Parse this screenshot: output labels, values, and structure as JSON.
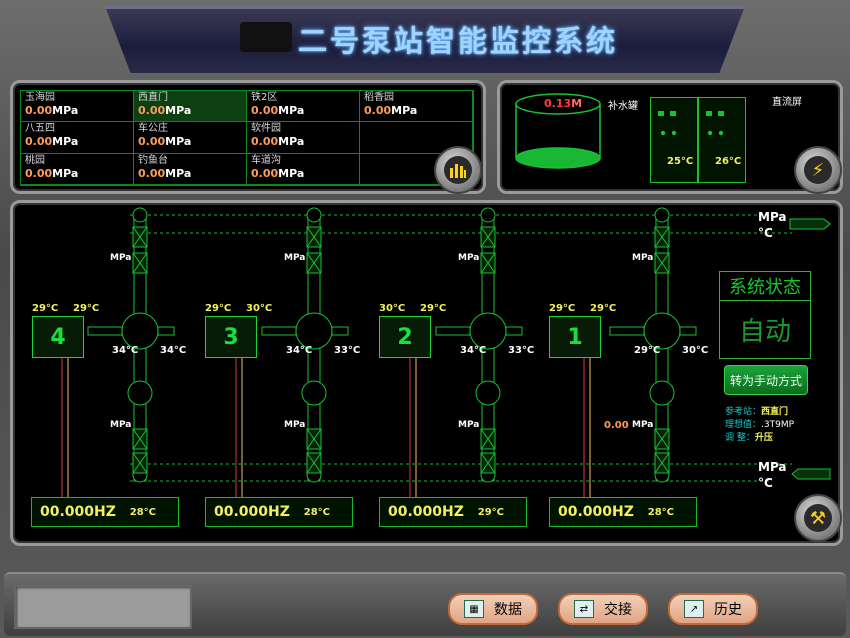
{
  "title": "二号泵站智能监控系统",
  "pressure_table": [
    {
      "name": "玉海园",
      "value": "0.00",
      "unit": "MPa"
    },
    {
      "name": "西直门",
      "value": "0.00",
      "unit": "MPa",
      "highlight": true
    },
    {
      "name": "铁2区",
      "value": "0.00",
      "unit": "MPa"
    },
    {
      "name": "稻香园",
      "value": "0.00",
      "unit": "MPa"
    },
    {
      "name": "八五四",
      "value": "0.00",
      "unit": "MPa"
    },
    {
      "name": "车公庄",
      "value": "0.00",
      "unit": "MPa"
    },
    {
      "name": "软件园",
      "value": "0.00",
      "unit": "MPa"
    },
    {
      "name": "",
      "value": "",
      "unit": ""
    },
    {
      "name": "桃园",
      "value": "0.00",
      "unit": "MPa"
    },
    {
      "name": "钓鱼台",
      "value": "0.00",
      "unit": "MPa"
    },
    {
      "name": "车道沟",
      "value": "0.00",
      "unit": "MPa"
    },
    {
      "name": "",
      "value": "",
      "unit": ""
    }
  ],
  "tank": {
    "level": "0.13",
    "unit": "M",
    "label": "补水罐"
  },
  "cabinet": {
    "label": "直流屏",
    "temps": [
      "25",
      "26"
    ],
    "temp_unit": "°C"
  },
  "outlet": {
    "pressure_unit": "MPa",
    "temp_unit": "°C"
  },
  "inlet": {
    "pressure_unit": "MPa",
    "temp_unit": "°C"
  },
  "pumps": [
    {
      "number": "4",
      "motor_t1": "29",
      "motor_t2": "29",
      "pipe_t1": "34",
      "pipe_t2": "34",
      "upper_pressure": "MPa",
      "lower_pressure": "MPa",
      "lower_value": "",
      "freq": "00.000",
      "freq_unit": "HZ",
      "temp": "28"
    },
    {
      "number": "3",
      "motor_t1": "29",
      "motor_t2": "30",
      "pipe_t1": "34",
      "pipe_t2": "33",
      "upper_pressure": "MPa",
      "lower_pressure": "MPa",
      "lower_value": "",
      "freq": "00.000",
      "freq_unit": "HZ",
      "temp": "28"
    },
    {
      "number": "2",
      "motor_t1": "30",
      "motor_t2": "29",
      "pipe_t1": "34",
      "pipe_t2": "33",
      "upper_pressure": "MPa",
      "lower_pressure": "MPa",
      "lower_value": "",
      "freq": "00.000",
      "freq_unit": "HZ",
      "temp": "29"
    },
    {
      "number": "1",
      "motor_t1": "29",
      "motor_t2": "29",
      "pipe_t1": "29",
      "pipe_t2": "30",
      "upper_pressure": "MPa",
      "lower_pressure": "MPa",
      "lower_value": "0.00",
      "freq": "00.000",
      "freq_unit": "HZ",
      "temp": "28"
    }
  ],
  "temp_unit": "°C",
  "system_status": {
    "header": "系统状态",
    "value": "自动"
  },
  "switch_button": "转为手动方式",
  "reference": {
    "station_label": "参考站：",
    "station": "西直门",
    "ideal_label": "理想值：",
    "ideal": ".3T9MP",
    "adjust_label": "调   整：",
    "adjust": "升压"
  },
  "bottom_buttons": [
    {
      "label": "数据",
      "icon": "table-icon"
    },
    {
      "label": "交接",
      "icon": "handover-icon"
    },
    {
      "label": "历史",
      "icon": "history-chart-icon"
    }
  ],
  "colors": {
    "green": "#18e03a",
    "orange": "#ff9c5a",
    "yellow": "#f3f05a"
  }
}
